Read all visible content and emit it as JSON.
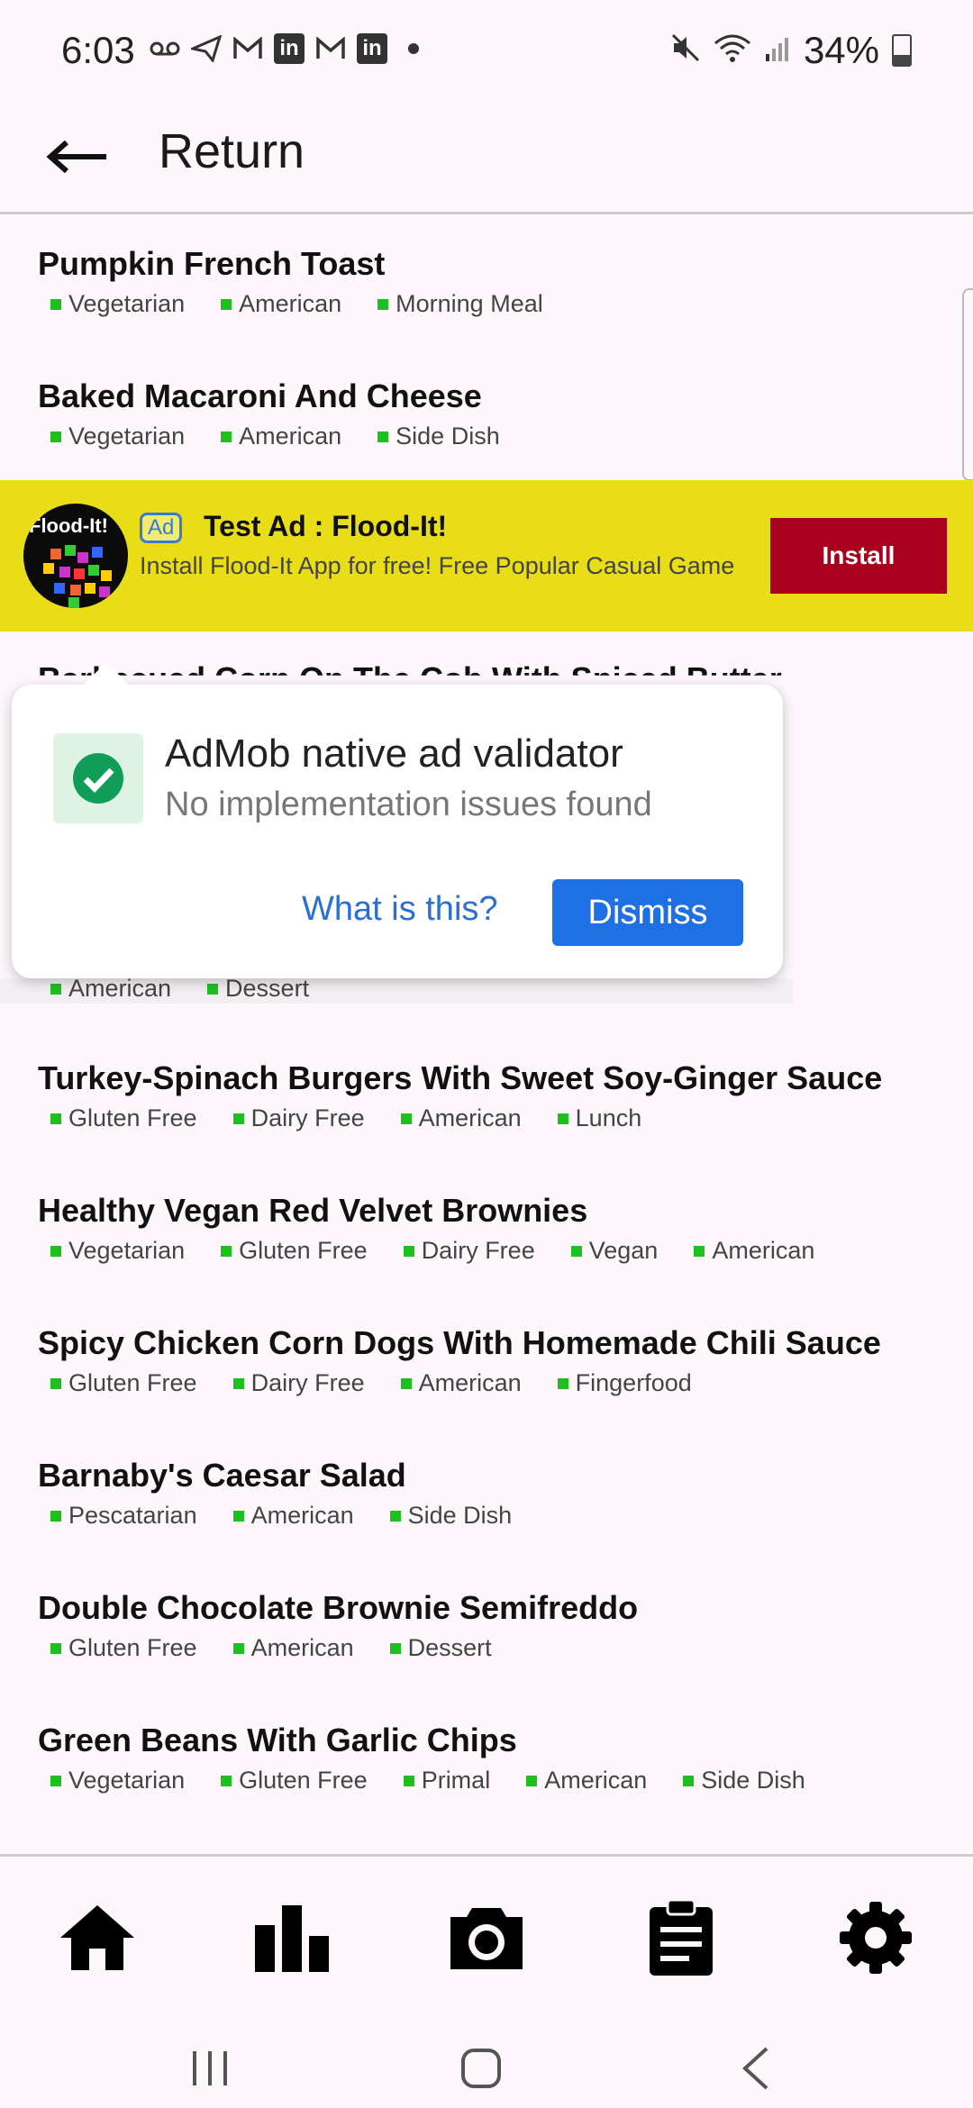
{
  "status": {
    "time": "6:03",
    "battery": "34%",
    "battery_level": 0.34
  },
  "appbar": {
    "title": "Return"
  },
  "recipes_top": [
    {
      "title": "Pumpkin French Toast",
      "tags": [
        "Vegetarian",
        "American",
        "Morning Meal"
      ]
    },
    {
      "title": "Baked Macaroni And Cheese",
      "tags": [
        "Vegetarian",
        "American",
        "Side Dish"
      ]
    }
  ],
  "ad": {
    "icon_text": "Flood-It!",
    "badge": "Ad",
    "title": "Test Ad : Flood-It!",
    "description": "Install Flood-It App for free! Free Popular Casual Game",
    "cta": "Install"
  },
  "hidden_recipe": {
    "title_partial": "Barbecued Corn On The Cob With Spiced Butter",
    "tags": [
      "American",
      "Dessert"
    ]
  },
  "validator": {
    "title": "AdMob native ad validator",
    "subtitle": "No implementation issues found",
    "link": "What is this?",
    "dismiss": "Dismiss"
  },
  "recipes_bottom": [
    {
      "title": "Turkey-Spinach Burgers With Sweet Soy-Ginger Sauce",
      "tags": [
        "Gluten Free",
        "Dairy Free",
        "American",
        "Lunch"
      ]
    },
    {
      "title": "Healthy Vegan Red Velvet Brownies",
      "tags": [
        "Vegetarian",
        "Gluten Free",
        "Dairy Free",
        "Vegan",
        "American"
      ]
    },
    {
      "title": "Spicy Chicken Corn Dogs With Homemade Chili Sauce",
      "tags": [
        "Gluten Free",
        "Dairy Free",
        "American",
        "Fingerfood"
      ]
    },
    {
      "title": "Barnaby's Caesar Salad",
      "tags": [
        "Pescatarian",
        "American",
        "Side Dish"
      ]
    },
    {
      "title": "Double Chocolate Brownie Semifreddo",
      "tags": [
        "Gluten Free",
        "American",
        "Dessert"
      ]
    },
    {
      "title": "Green Beans With Garlic Chips",
      "tags": [
        "Vegetarian",
        "Gluten Free",
        "Primal",
        "American",
        "Side Dish"
      ]
    }
  ],
  "bottom_nav": [
    {
      "icon": "home-icon"
    },
    {
      "icon": "bar-chart-icon"
    },
    {
      "icon": "camera-icon"
    },
    {
      "icon": "clipboard-icon"
    },
    {
      "icon": "gear-icon"
    }
  ],
  "colors": {
    "tag": "#1ec01e",
    "ad_bg": "#e8dd16",
    "install": "#a8001d",
    "dismiss": "#1f6fe5"
  }
}
